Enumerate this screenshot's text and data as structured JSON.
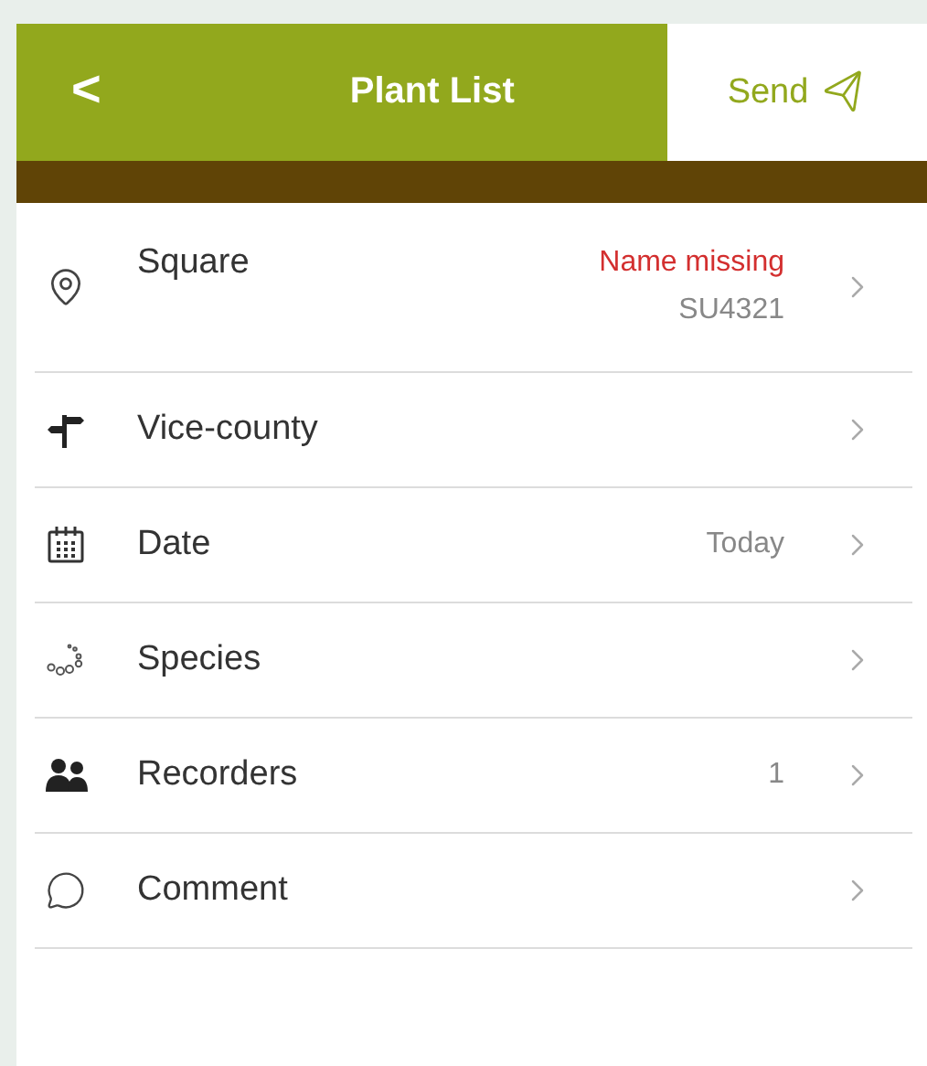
{
  "header": {
    "back": "<",
    "title": "Plant List",
    "send": "Send"
  },
  "rows": [
    {
      "kind": "location",
      "label": "Square",
      "warning": "Name missing",
      "value": "SU4321"
    },
    {
      "kind": "signpost",
      "label": "Vice-county"
    },
    {
      "kind": "calendar",
      "label": "Date",
      "value": "Today"
    },
    {
      "kind": "species",
      "label": "Species"
    },
    {
      "kind": "people",
      "label": "Recorders",
      "value": "1"
    },
    {
      "kind": "comment",
      "label": "Comment"
    }
  ]
}
